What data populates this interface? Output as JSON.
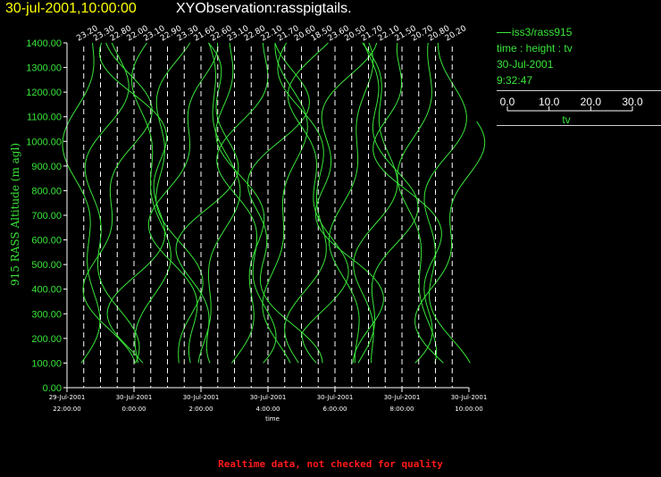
{
  "header": {
    "date_label": "30-jul-2001,10:00:00",
    "observation_label": "XYObservation:rasspigtails."
  },
  "legend": {
    "series_label": "iss3/rass915",
    "axes_label": "time : height : tv",
    "date": "30-Jul-2001",
    "time": "9:32:47",
    "scale_ticks": [
      "0.0",
      "10.0",
      "20.0",
      "30.0"
    ],
    "scale_label": "tv"
  },
  "footer": "Realtime data, not checked for quality",
  "colors": {
    "background": "#000000",
    "profile_line": "#39e639",
    "axis_text": "#39e639",
    "title_date": "#ffff00",
    "footer": "#ff1a1a"
  },
  "chart_data": {
    "type": "line",
    "title": "",
    "xlabel": "time",
    "ylabel": "915 RASS Altitude (m agl)",
    "ylim": [
      0,
      1400
    ],
    "y_ticks": [
      "0.00",
      "100.00",
      "200.00",
      "300.00",
      "400.00",
      "500.00",
      "600.00",
      "700.00",
      "800.00",
      "900.00",
      "1000.00",
      "1100.00",
      "1200.00",
      "1300.00",
      "1400.00"
    ],
    "x_ticks": [
      {
        "date": "29-Jul-2001",
        "time": "22:00:00"
      },
      {
        "date": "30-Jul-2001",
        "time": "0:00:00"
      },
      {
        "date": "30-Jul-2001",
        "time": "2:00:00"
      },
      {
        "date": "30-Jul-2001",
        "time": "4:00:00"
      },
      {
        "date": "30-Jul-2001",
        "time": "6:00:00"
      },
      {
        "date": "30-Jul-2001",
        "time": "8:00:00"
      },
      {
        "date": "30-Jul-2001",
        "time": "10:00:00"
      }
    ],
    "x_range_hours": [
      -2,
      10
    ],
    "profile_scale": {
      "tv_per_hour": 30,
      "label": "tv"
    },
    "profiles": [
      {
        "label": "23.20",
        "t": -1.5
      },
      {
        "label": "23.30",
        "t": -1.0
      },
      {
        "label": "22.80",
        "t": -0.5
      },
      {
        "label": "22.00",
        "t": 0.0
      },
      {
        "label": "23.10",
        "t": 0.5
      },
      {
        "label": "22.90",
        "t": 1.0
      },
      {
        "label": "23.30",
        "t": 1.5
      },
      {
        "label": "21.60",
        "t": 2.0
      },
      {
        "label": "22.60",
        "t": 2.5
      },
      {
        "label": "23.10",
        "t": 3.0
      },
      {
        "label": "22.80",
        "t": 3.5
      },
      {
        "label": "22.10",
        "t": 4.0
      },
      {
        "label": "21.70",
        "t": 4.5
      },
      {
        "label": "20.60",
        "t": 5.0
      },
      {
        "label": "18.50",
        "t": 5.5
      },
      {
        "label": "23.60",
        "t": 6.0
      },
      {
        "label": "20.50",
        "t": 6.5
      },
      {
        "label": "21.70",
        "t": 7.0
      },
      {
        "label": "22.10",
        "t": 7.5
      },
      {
        "label": "21.50",
        "t": 8.0
      },
      {
        "label": "20.70",
        "t": 8.5
      },
      {
        "label": "20.80",
        "t": 9.0
      },
      {
        "label": "20.20",
        "t": 9.5
      }
    ],
    "grid": false,
    "legend_position": "right"
  }
}
